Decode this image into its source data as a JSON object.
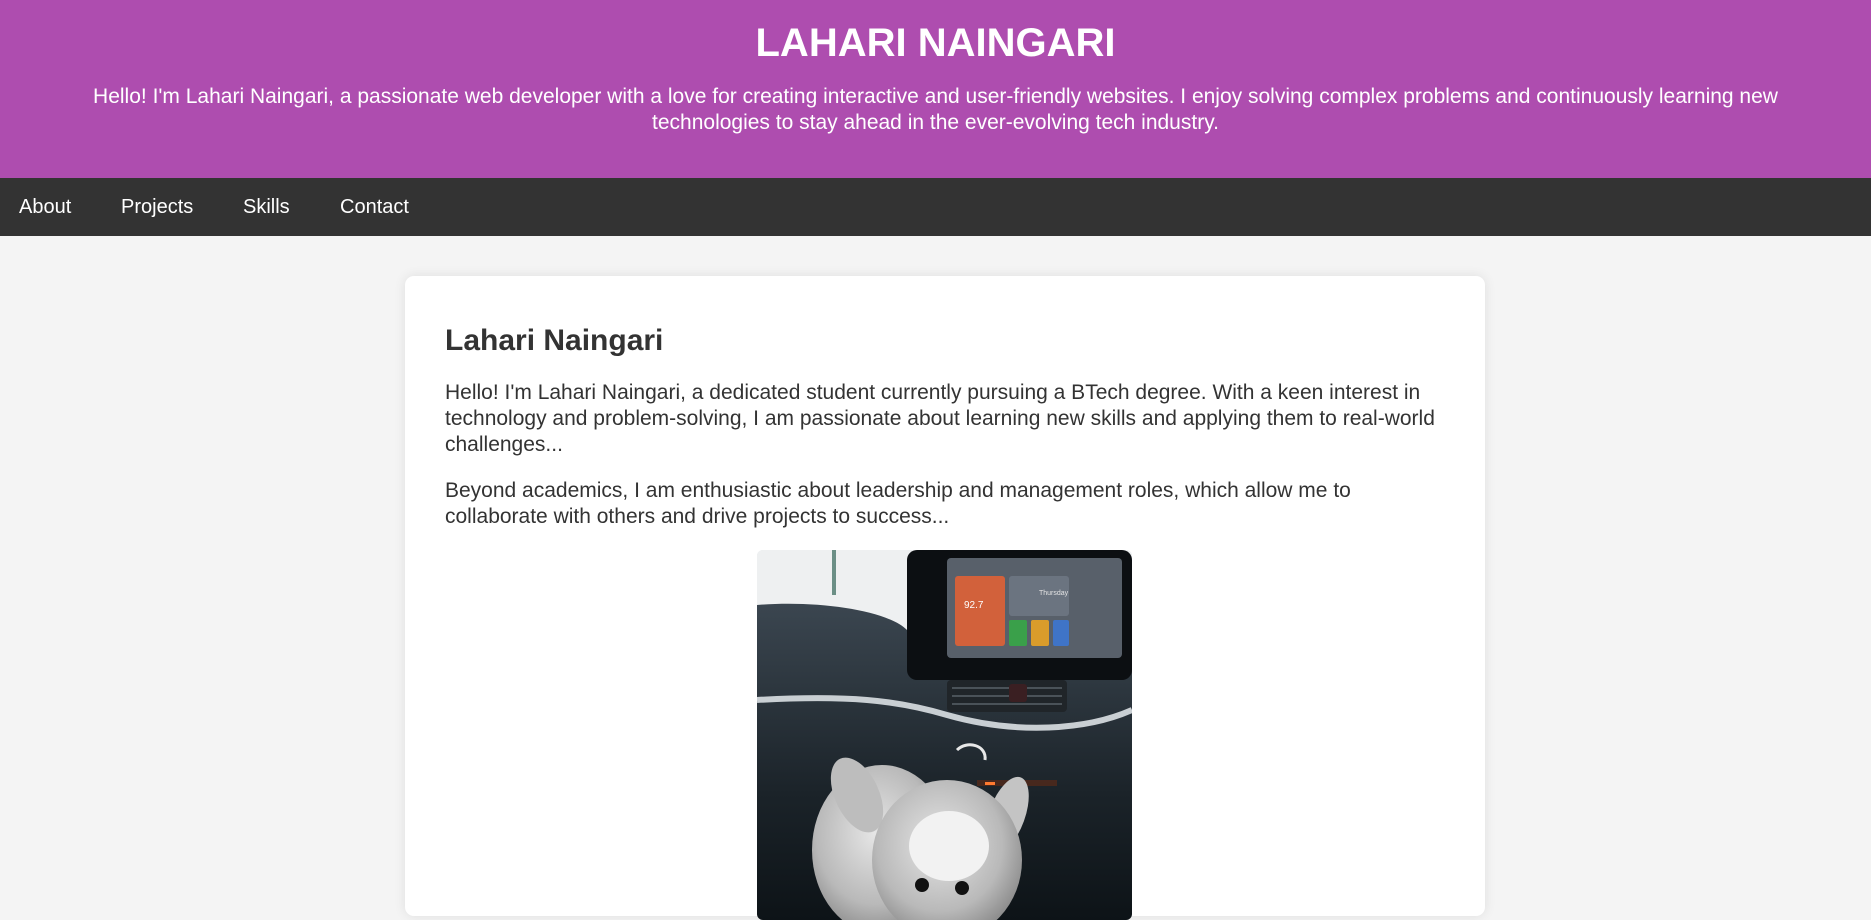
{
  "header": {
    "title": "LAHARI NAINGARI",
    "intro": "Hello! I'm Lahari Naingari, a passionate web developer with a love for creating interactive and user-friendly websites. I enjoy solving complex problems and continuously learning new technologies to stay ahead in the ever-evolving tech industry."
  },
  "nav": {
    "items": [
      {
        "label": "About"
      },
      {
        "label": "Projects"
      },
      {
        "label": "Skills"
      },
      {
        "label": "Contact"
      }
    ]
  },
  "about": {
    "heading": "Lahari Naingari",
    "paragraph_1": "Hello! I'm Lahari Naingari, a dedicated student currently pursuing a BTech degree. With a keen interest in technology and problem-solving, I am passionate about learning new skills and applying them to real-world challenges...",
    "paragraph_2": "Beyond academics, I am enthusiastic about leadership and management roles, which allow me to collaborate with others and drive projects to success...",
    "photo": {
      "radio_label": "92.7",
      "day_label": "Thursday"
    }
  },
  "colors": {
    "header_bg": "#ae4daf",
    "nav_bg": "#333333",
    "page_bg": "#f4f4f4",
    "card_bg": "#ffffff",
    "text": "#333333"
  }
}
